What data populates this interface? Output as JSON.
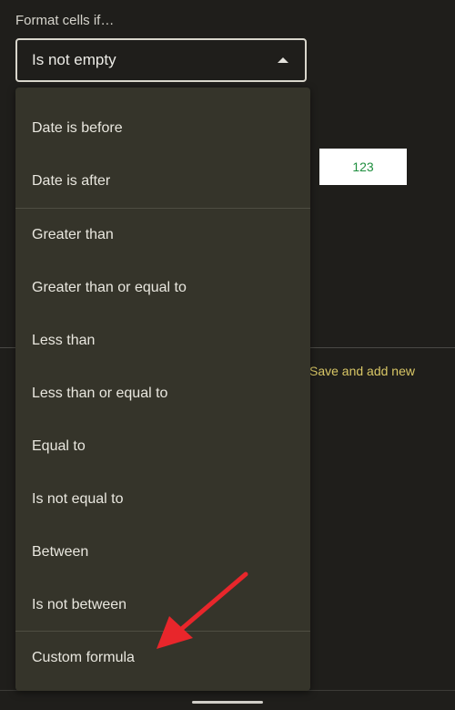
{
  "header": {
    "label": "Format cells if…"
  },
  "condition_select": {
    "selected_value": "Is not empty"
  },
  "preview": {
    "sample_text": "123"
  },
  "actions": {
    "save_and_add_new": "Save and add new"
  },
  "dropdown": {
    "items": [
      "Date is before",
      "Date is after",
      "Greater than",
      "Greater than or equal to",
      "Less than",
      "Less than or equal to",
      "Equal to",
      "Is not equal to",
      "Between",
      "Is not between",
      "Custom formula"
    ]
  },
  "colors": {
    "background": "#1f1e1b",
    "menu_background": "#35342a",
    "accent_yellow": "#d9c766",
    "preview_text_green": "#1e8e3e",
    "annotation_arrow_red": "#e8262b"
  },
  "icons": {
    "select_toggle": "triangle-up-icon",
    "annotation": "red-arrow-icon"
  }
}
